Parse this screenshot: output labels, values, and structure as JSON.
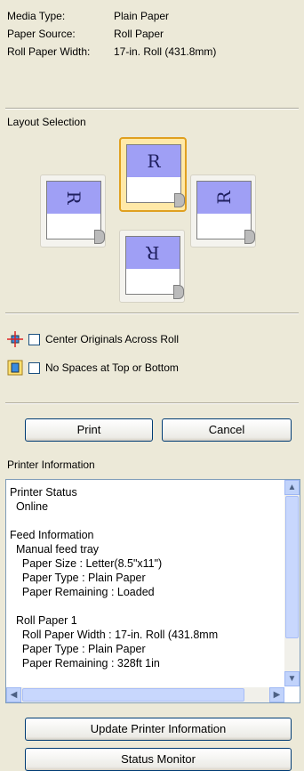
{
  "info": {
    "media_type_label": "Media Type:",
    "media_type_value": "Plain Paper",
    "paper_source_label": "Paper Source:",
    "paper_source_value": "Roll Paper",
    "roll_width_label": "Roll Paper Width:",
    "roll_width_value": "17-in. Roll (431.8mm)"
  },
  "layout": {
    "title": "Layout Selection",
    "letter": "R"
  },
  "options": {
    "center_label": "Center Originals Across Roll",
    "nospace_label": "No Spaces at Top or Bottom"
  },
  "buttons": {
    "print": "Print",
    "cancel": "Cancel",
    "update": "Update Printer Information",
    "status_monitor": "Status Monitor"
  },
  "printer_info": {
    "title": "Printer Information",
    "lines": [
      "Printer Status",
      "  Online",
      "",
      "Feed Information",
      "  Manual feed tray",
      "    Paper Size : Letter(8.5\"x11\")",
      "    Paper Type : Plain Paper",
      "    Paper Remaining : Loaded",
      "",
      "  Roll Paper 1",
      "    Roll Paper Width : 17-in. Roll (431.8mm",
      "    Paper Type : Plain Paper",
      "    Paper Remaining : 328ft 1in"
    ]
  },
  "colors": {
    "accent": "#E0A020",
    "paper_top": "#9F9FF5"
  }
}
